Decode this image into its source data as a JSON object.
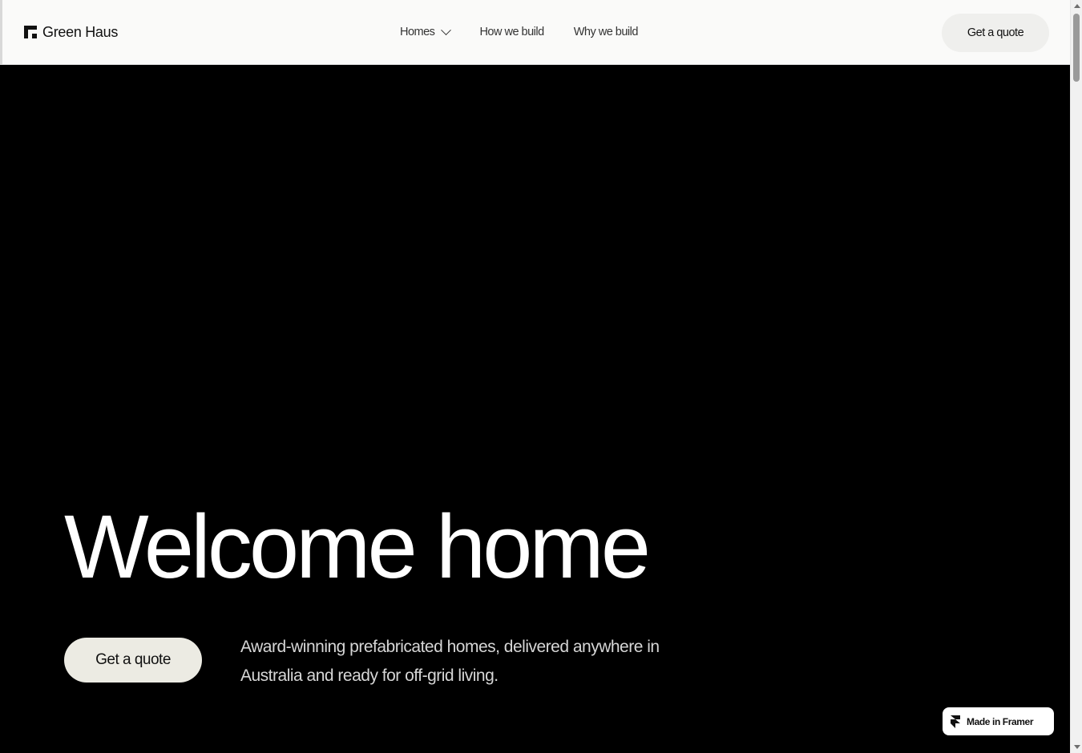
{
  "header": {
    "brand": "Green Haus",
    "nav": [
      {
        "label": "Homes",
        "has_dropdown": true
      },
      {
        "label": "How we build"
      },
      {
        "label": "Why we build"
      }
    ],
    "cta_label": "Get a quote"
  },
  "hero": {
    "title": "Welcome home",
    "cta_label": "Get a quote",
    "description": "Award-winning prefabricated homes, delivered anywhere in Australia and ready for off-grid living."
  },
  "badge": {
    "label": "Made in Framer",
    "icon": "framer-icon"
  },
  "colors": {
    "header_bg": "#fafaf9",
    "hero_bg": "#000000",
    "hero_text": "#ffffff",
    "hero_cta_bg": "#ecebe3",
    "header_cta_bg": "#efefed"
  }
}
